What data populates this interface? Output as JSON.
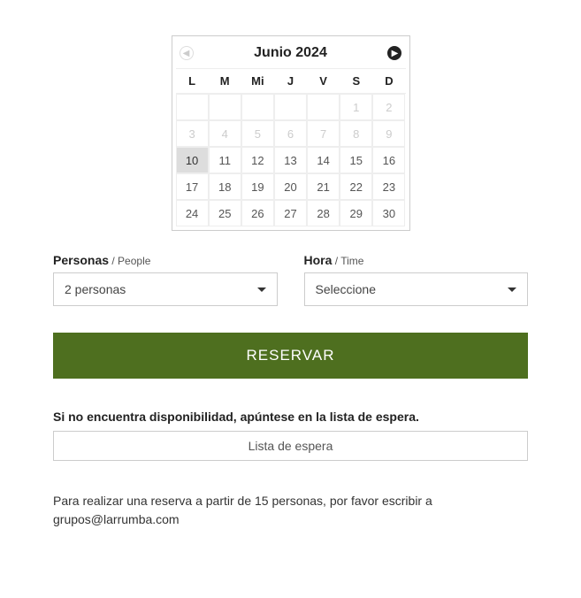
{
  "calendar": {
    "title": "Junio 2024",
    "dow": [
      "L",
      "M",
      "Mi",
      "J",
      "V",
      "S",
      "D"
    ],
    "cells": [
      {
        "n": "",
        "cls": "empty"
      },
      {
        "n": "",
        "cls": "empty"
      },
      {
        "n": "",
        "cls": "empty"
      },
      {
        "n": "",
        "cls": "empty"
      },
      {
        "n": "",
        "cls": "empty"
      },
      {
        "n": "1",
        "cls": "disabled"
      },
      {
        "n": "2",
        "cls": "disabled"
      },
      {
        "n": "3",
        "cls": "disabled"
      },
      {
        "n": "4",
        "cls": "disabled"
      },
      {
        "n": "5",
        "cls": "disabled"
      },
      {
        "n": "6",
        "cls": "disabled"
      },
      {
        "n": "7",
        "cls": "disabled"
      },
      {
        "n": "8",
        "cls": "disabled"
      },
      {
        "n": "9",
        "cls": "disabled"
      },
      {
        "n": "10",
        "cls": "selected"
      },
      {
        "n": "11",
        "cls": ""
      },
      {
        "n": "12",
        "cls": ""
      },
      {
        "n": "13",
        "cls": ""
      },
      {
        "n": "14",
        "cls": ""
      },
      {
        "n": "15",
        "cls": ""
      },
      {
        "n": "16",
        "cls": ""
      },
      {
        "n": "17",
        "cls": ""
      },
      {
        "n": "18",
        "cls": ""
      },
      {
        "n": "19",
        "cls": ""
      },
      {
        "n": "20",
        "cls": ""
      },
      {
        "n": "21",
        "cls": ""
      },
      {
        "n": "22",
        "cls": ""
      },
      {
        "n": "23",
        "cls": ""
      },
      {
        "n": "24",
        "cls": ""
      },
      {
        "n": "25",
        "cls": ""
      },
      {
        "n": "26",
        "cls": ""
      },
      {
        "n": "27",
        "cls": ""
      },
      {
        "n": "28",
        "cls": ""
      },
      {
        "n": "29",
        "cls": ""
      },
      {
        "n": "30",
        "cls": ""
      }
    ]
  },
  "people": {
    "label_main": "Personas",
    "label_sub": " / People",
    "value": "2 personas"
  },
  "time": {
    "label_main": "Hora",
    "label_sub": " / Time",
    "value": "Seleccione"
  },
  "reserve_label": "RESERVAR",
  "waitlist": {
    "text": "Si no encuentra disponibilidad, apúntese en la lista de espera.",
    "button": "Lista de espera"
  },
  "footer": "Para realizar una reserva a partir de 15 personas, por favor escribir a grupos@larrumba.com"
}
